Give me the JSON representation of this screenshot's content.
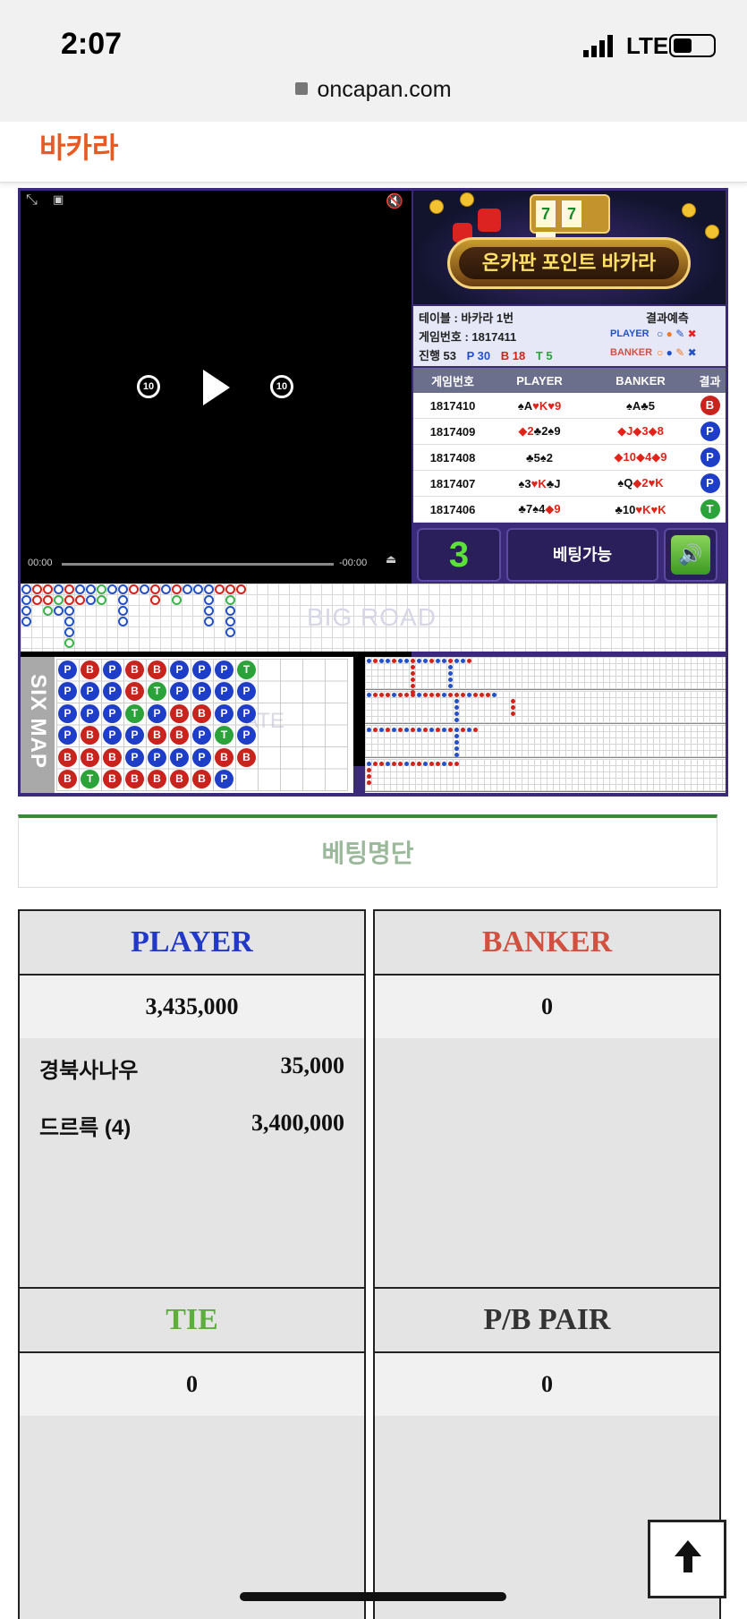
{
  "status_bar": {
    "time": "2:07",
    "network": "LTE",
    "url": "oncapan.com"
  },
  "header": {
    "title": "바카라"
  },
  "video": {
    "time_current": "00:00",
    "time_remaining": "-00:00",
    "skip_back": "10",
    "skip_forward": "10"
  },
  "banner": {
    "sign_text": "온카판 포인트 바카라",
    "slot_digits": [
      "7",
      "7",
      "7"
    ]
  },
  "table_info": {
    "table": "테이블 : 바카라 1번",
    "game_no": "게임번호 : 1817411",
    "progress": "진행 53",
    "p_count": "P 30",
    "b_count": "B 18",
    "t_count": "T 5",
    "prediction_label": "결과예측",
    "player_label": "PLAYER",
    "banker_label": "BANKER"
  },
  "results": {
    "headers": [
      "게임번호",
      "PLAYER",
      "BANKER",
      "결과"
    ],
    "rows": [
      {
        "no": "1817410",
        "player": [
          [
            "♠A",
            "black"
          ],
          [
            "♥K",
            "red"
          ],
          [
            "♥9",
            "red"
          ]
        ],
        "banker": [
          [
            "♠A",
            "black"
          ],
          [
            "♣5",
            "black"
          ]
        ],
        "result": "B"
      },
      {
        "no": "1817409",
        "player": [
          [
            "◆2",
            "red"
          ],
          [
            "♣2",
            "black"
          ],
          [
            "♠9",
            "black"
          ]
        ],
        "banker": [
          [
            "◆J",
            "red"
          ],
          [
            "◆3",
            "red"
          ],
          [
            "◆8",
            "red"
          ]
        ],
        "result": "P"
      },
      {
        "no": "1817408",
        "player": [
          [
            "♣5",
            "black"
          ],
          [
            "♠2",
            "black"
          ]
        ],
        "banker": [
          [
            "◆10",
            "red"
          ],
          [
            "◆4",
            "red"
          ],
          [
            "◆9",
            "red"
          ]
        ],
        "result": "P"
      },
      {
        "no": "1817407",
        "player": [
          [
            "♠3",
            "black"
          ],
          [
            "♥K",
            "red"
          ],
          [
            "♣J",
            "black"
          ]
        ],
        "banker": [
          [
            "♠Q",
            "black"
          ],
          [
            "◆2",
            "red"
          ],
          [
            "♥K",
            "red"
          ]
        ],
        "result": "P"
      },
      {
        "no": "1817406",
        "player": [
          [
            "♣7",
            "black"
          ],
          [
            "♠4",
            "black"
          ],
          [
            "◆9",
            "red"
          ]
        ],
        "banker": [
          [
            "♣10",
            "black"
          ],
          [
            "♥K",
            "red"
          ],
          [
            "♥K",
            "red"
          ]
        ],
        "result": "T"
      }
    ]
  },
  "controls": {
    "countdown": "3",
    "bet_status": "베팅가능",
    "sound_icon": "speaker-icon"
  },
  "bigroad": {
    "label": "BIG ROAD",
    "columns": [
      [
        "b",
        "b",
        "b",
        "b"
      ],
      [
        "r",
        "r"
      ],
      [
        "r",
        "r",
        "g"
      ],
      [
        "b",
        "g",
        "b"
      ],
      [
        "r",
        "r",
        "b",
        "b",
        "b",
        "g"
      ],
      [
        "b",
        "r"
      ],
      [
        "b",
        "b"
      ],
      [
        "g",
        "g"
      ],
      [
        "b"
      ],
      [
        "b",
        "b",
        "b",
        "b"
      ],
      [
        "r"
      ],
      [
        "b"
      ],
      [
        "r",
        "r"
      ],
      [
        "b"
      ],
      [
        "r",
        "g"
      ],
      [
        "b"
      ],
      [
        "b"
      ],
      [
        "b",
        "b",
        "b",
        "b"
      ],
      [
        "r"
      ],
      [
        "r",
        "g",
        "b",
        "b",
        "b"
      ],
      [
        "r"
      ]
    ]
  },
  "sixmap": {
    "label": "SIX MAP",
    "watermark": "ATE",
    "columns": [
      [
        "P",
        "P",
        "P",
        "P",
        "B",
        "B"
      ],
      [
        "B",
        "P",
        "P",
        "B",
        "B",
        "T"
      ],
      [
        "P",
        "P",
        "P",
        "P",
        "B",
        "B"
      ],
      [
        "B",
        "B",
        "T",
        "P",
        "P",
        "B"
      ],
      [
        "B",
        "T",
        "P",
        "B",
        "P",
        "B"
      ],
      [
        "P",
        "P",
        "B",
        "B",
        "P",
        "B"
      ],
      [
        "P",
        "P",
        "B",
        "P",
        "P",
        "B"
      ],
      [
        "P",
        "P",
        "P",
        "T",
        "B",
        "P"
      ],
      [
        "T",
        "P",
        "P",
        "P",
        "B",
        ""
      ]
    ]
  },
  "betting_list": {
    "title": "베팅명단"
  },
  "panels": {
    "player": {
      "title": "PLAYER",
      "total": "3,435,000",
      "bets": [
        {
          "name": "경북사나우",
          "amount": "35,000"
        },
        {
          "name": "드르륵 (4)",
          "amount": "3,400,000"
        }
      ],
      "color": "#2238c8"
    },
    "banker": {
      "title": "BANKER",
      "total": "0",
      "color": "#d2503f"
    },
    "tie": {
      "title": "TIE",
      "total": "0",
      "color": "#5dae3f"
    },
    "pair": {
      "title": "P/B PAIR",
      "total": "0",
      "color": "#333333"
    }
  }
}
